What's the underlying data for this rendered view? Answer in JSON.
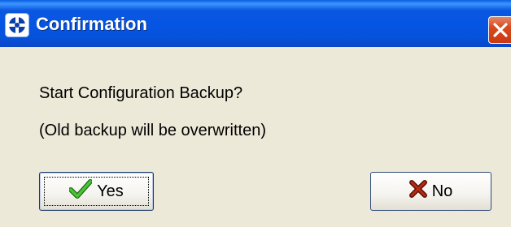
{
  "window": {
    "title": "Confirmation",
    "title_icon": "app-crosshair-icon",
    "close_icon": "close-icon"
  },
  "message": {
    "line1": "Start Configuration Backup?",
    "line2": "(Old backup will be overwritten)"
  },
  "buttons": {
    "yes": {
      "label": "Yes",
      "icon": "checkmark-icon",
      "focused": true
    },
    "no": {
      "label": "No",
      "icon": "x-mark-icon"
    }
  },
  "colors": {
    "titlebar": "#0654e4",
    "close_button": "#d8491f",
    "dialog_background": "#ece9d8",
    "check_green": "#2e9b1e",
    "x_dark_red": "#8c1c0c"
  }
}
